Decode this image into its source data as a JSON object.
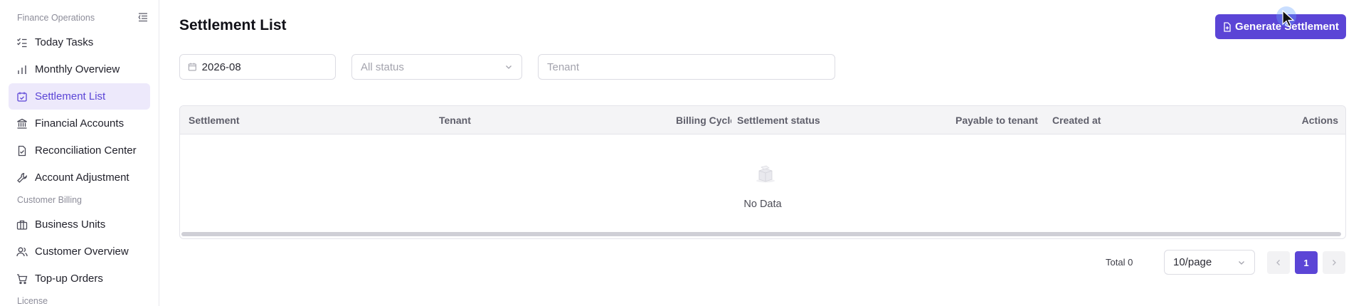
{
  "sidebar": {
    "sections": [
      {
        "label": "Finance Operations"
      },
      {
        "label": "Customer Billing"
      },
      {
        "label": "License"
      }
    ],
    "items": [
      {
        "label": "Today Tasks",
        "icon": "checklist-icon"
      },
      {
        "label": "Monthly Overview",
        "icon": "bar-chart-icon"
      },
      {
        "label": "Settlement List",
        "icon": "calendar-check-icon",
        "active": true
      },
      {
        "label": "Financial Accounts",
        "icon": "bank-icon"
      },
      {
        "label": "Reconciliation Center",
        "icon": "file-check-icon"
      },
      {
        "label": "Account Adjustment",
        "icon": "wrench-icon"
      },
      {
        "label": "Business Units",
        "icon": "briefcase-icon"
      },
      {
        "label": "Customer Overview",
        "icon": "users-icon"
      },
      {
        "label": "Top-up Orders",
        "icon": "cart-icon"
      }
    ]
  },
  "header": {
    "title": "Settlement List",
    "generate_label": "Generate Settlement"
  },
  "filters": {
    "month_value": "2026-08",
    "status_placeholder": "All status",
    "tenant_placeholder": "Tenant"
  },
  "table": {
    "columns": [
      "Settlement",
      "Tenant",
      "Billing Cycle",
      "Settlement status",
      "Payable to tenant",
      "Created at",
      "Actions"
    ],
    "empty_text": "No Data"
  },
  "pagination": {
    "total_label": "Total 0",
    "page_size": "10/page",
    "current_page": "1"
  },
  "colors": {
    "accent": "#5b45d6",
    "active_bg": "#ede9fb"
  }
}
